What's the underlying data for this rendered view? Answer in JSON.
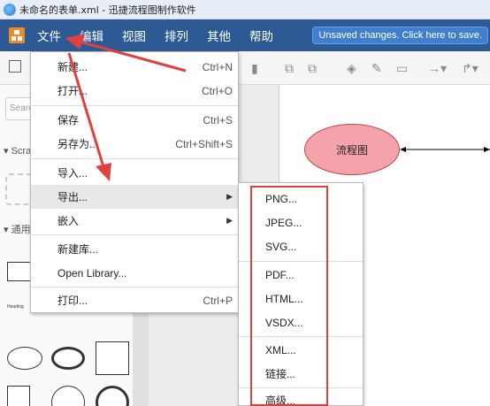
{
  "window": {
    "title": "未命名的表单.xml - 迅捷流程图制作软件"
  },
  "menubar": {
    "items": [
      "文件",
      "编辑",
      "视图",
      "排列",
      "其他",
      "帮助"
    ],
    "unsaved_notice": "Unsaved changes. Click here to save."
  },
  "sidebar": {
    "search_placeholder": "Search",
    "scratchpad_label": "Scratchpad",
    "general_label": "通用",
    "heading_sample": "Heading"
  },
  "canvas": {
    "node_label": "流程图"
  },
  "file_menu": {
    "items": [
      {
        "label": "新建...",
        "shortcut": "Ctrl+N"
      },
      {
        "label": "打开...",
        "shortcut": "Ctrl+O"
      },
      {
        "label": "保存",
        "shortcut": "Ctrl+S"
      },
      {
        "label": "另存为...",
        "shortcut": "Ctrl+Shift+S"
      },
      {
        "label": "导入...",
        "shortcut": ""
      },
      {
        "label": "导出...",
        "shortcut": ""
      },
      {
        "label": "嵌入",
        "shortcut": ""
      },
      {
        "label": "新建库...",
        "shortcut": ""
      },
      {
        "label": "Open Library...",
        "shortcut": ""
      },
      {
        "label": "打印...",
        "shortcut": "Ctrl+P"
      }
    ]
  },
  "export_menu": {
    "items": [
      "PNG...",
      "JPEG...",
      "SVG...",
      "PDF...",
      "HTML...",
      "VSDX...",
      "XML...",
      "链接...",
      "高级..."
    ]
  },
  "colors": {
    "menubar_bg": "#2d5a95",
    "annotation_red": "#e04040",
    "node_fill": "#f5a3aa"
  }
}
